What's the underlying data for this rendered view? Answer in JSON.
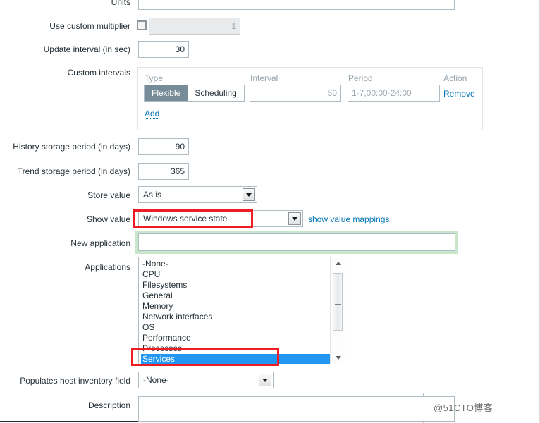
{
  "form": {
    "units": {
      "label": "Units",
      "value": ""
    },
    "custom_multiplier": {
      "label": "Use custom multiplier",
      "checked": false,
      "value": "1"
    },
    "update_interval": {
      "label": "Update interval (in sec)",
      "value": "30"
    },
    "custom_intervals": {
      "label": "Custom intervals",
      "columns": [
        "Type",
        "Interval",
        "Period",
        "Action"
      ],
      "rows": [
        {
          "type_options": [
            "Flexible",
            "Scheduling"
          ],
          "type_selected": "Flexible",
          "interval": "50",
          "period": "1-7,00:00-24:00",
          "action": "Remove"
        }
      ],
      "add_label": "Add"
    },
    "history_storage": {
      "label": "History storage period (in days)",
      "value": "90"
    },
    "trend_storage": {
      "label": "Trend storage period (in days)",
      "value": "365"
    },
    "store_value": {
      "label": "Store value",
      "value": "As is"
    },
    "show_value": {
      "label": "Show value",
      "value": "Windows service state",
      "link": "show value mappings",
      "highlighted": true
    },
    "new_application": {
      "label": "New application",
      "value": "",
      "focused": true
    },
    "applications": {
      "label": "Applications",
      "items": [
        "-None-",
        "CPU",
        "Filesystems",
        "General",
        "Memory",
        "Network interfaces",
        "OS",
        "Performance",
        "Processes",
        "Services"
      ],
      "selected": "Services"
    },
    "host_inventory": {
      "label": "Populates host inventory field",
      "value": "-None-"
    },
    "description": {
      "label": "Description",
      "value": ""
    }
  },
  "watermark": {
    "text": "@51CTO博客"
  },
  "colors": {
    "accent_link": "#0275b8",
    "selected_row": "#2196f3",
    "annotation_red": "#ee1c23",
    "focus_green": "#c8e6c9",
    "segment_active": "#768d99"
  }
}
